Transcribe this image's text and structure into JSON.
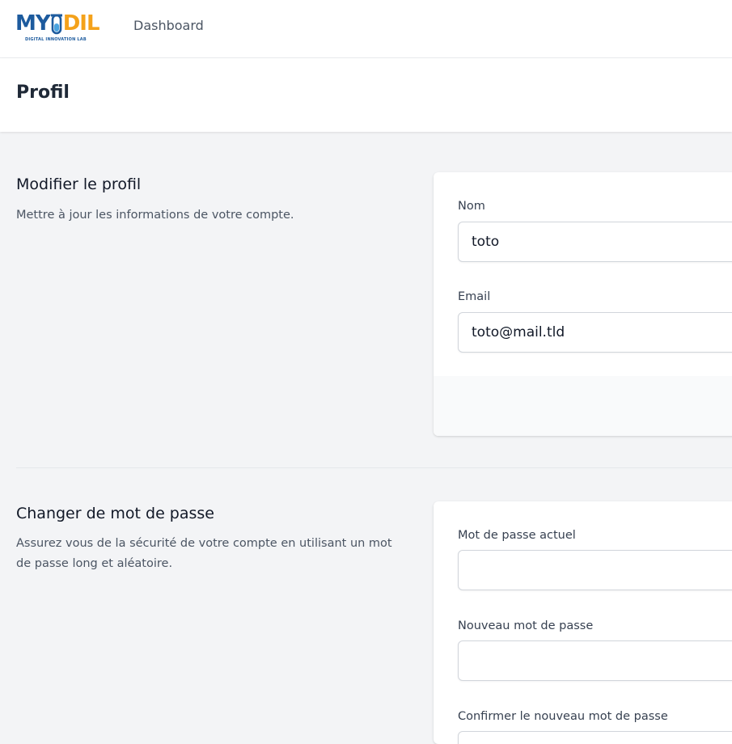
{
  "brand": {
    "logo_main_left": "MY",
    "logo_main_right": "DIL",
    "logo_subtitle": "DIGITAL INNOVATION LAB",
    "colors": {
      "blue": "#1d5b9e",
      "orange": "#f4a21b"
    }
  },
  "nav": {
    "dashboard_label": "Dashboard"
  },
  "header": {
    "title": "Profil"
  },
  "profile_section": {
    "title": "Modifier le profil",
    "description": "Mettre à jour les informations de votre compte.",
    "name_label": "Nom",
    "name_value": "toto",
    "email_label": "Email",
    "email_value": "toto@mail.tld"
  },
  "password_section": {
    "title": "Changer de mot de passe",
    "description": "Assurez vous de la sécurité de votre compte en utilisant un mot de passe long et aléatoire.",
    "current_label": "Mot de passe actuel",
    "current_value": "",
    "new_label": "Nouveau mot de passe",
    "new_value": "",
    "confirm_label": "Confirmer le nouveau mot de passe",
    "confirm_value": ""
  }
}
